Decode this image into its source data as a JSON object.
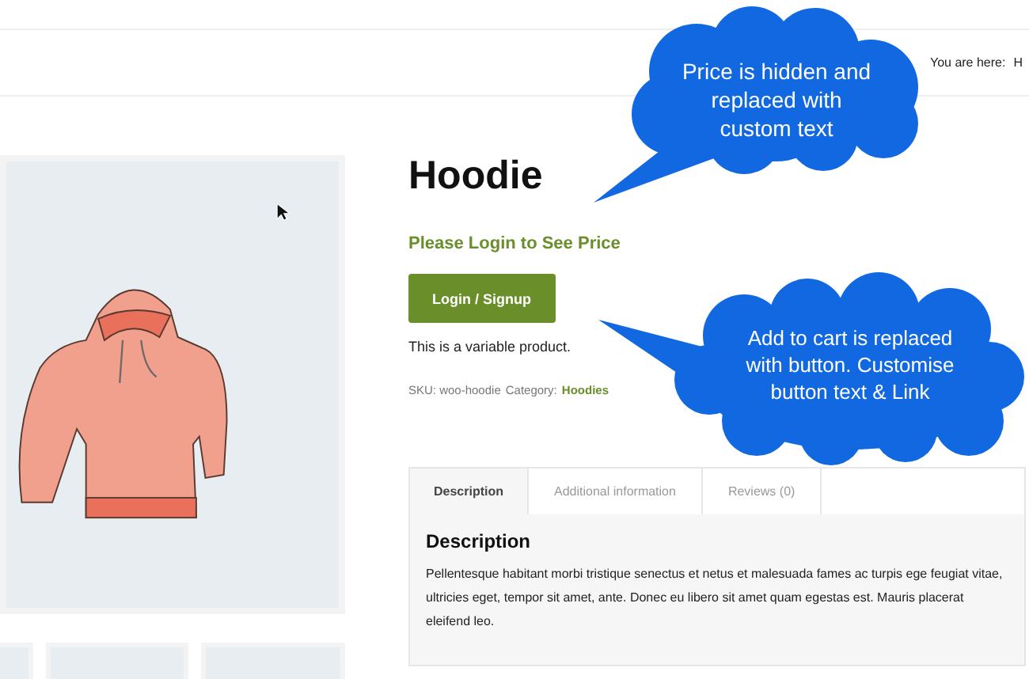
{
  "breadcrumb": {
    "label": "You are here:",
    "items": [
      "H"
    ]
  },
  "product": {
    "title": "Hoodie",
    "price_notice": "Please Login to See Price",
    "button": "Login / Signup",
    "short_description": "This is a variable product.",
    "sku_label": "SKU:",
    "sku": "woo-hoodie",
    "category_label": "Category:",
    "category": "Hoodies"
  },
  "tabs": [
    {
      "label": "Description",
      "selected": true
    },
    {
      "label": "Additional information",
      "selected": false
    },
    {
      "label": "Reviews (0)",
      "selected": false
    }
  ],
  "panel": {
    "heading": "Description",
    "text": "Pellentesque habitant morbi tristique senectus et netus et malesuada fames ac turpis ege feugiat vitae, ultricies eget, tempor sit amet, ante. Donec eu libero sit amet quam egestas est. Mauris placerat eleifend leo."
  },
  "annotations": [
    {
      "text": "Price is hidden and replaced with custom text"
    },
    {
      "text": "Add to cart is replaced with button. Customise button text & Link"
    }
  ]
}
